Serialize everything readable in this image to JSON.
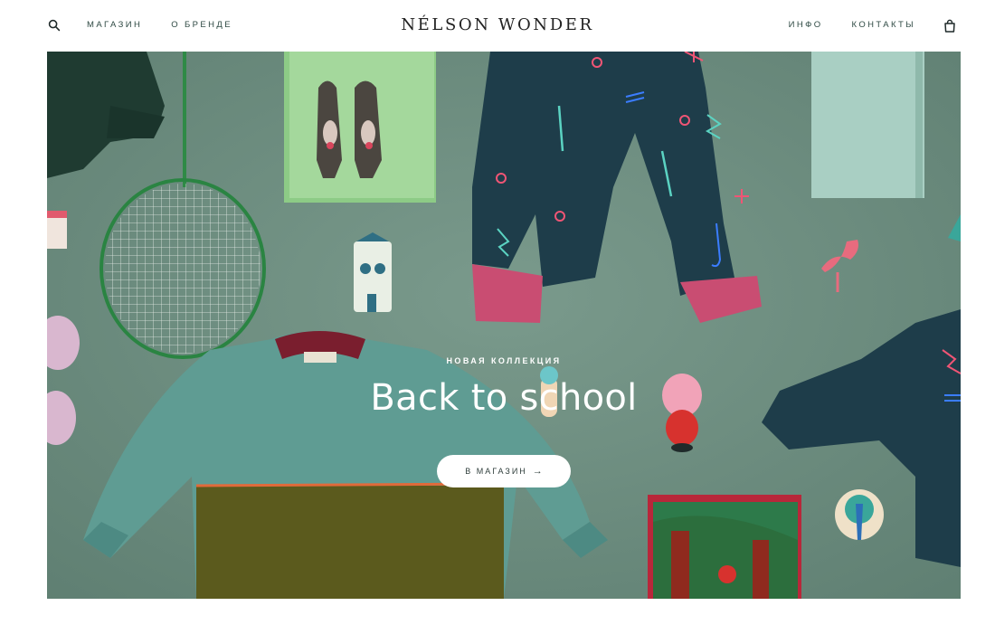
{
  "brand": {
    "name": "NÉLSON WONDER"
  },
  "nav": {
    "left": [
      {
        "label": "МАГАЗИН"
      },
      {
        "label": "О БРЕНДЕ"
      }
    ],
    "right": [
      {
        "label": "ИНФО"
      },
      {
        "label": "КОНТАКТЫ"
      }
    ],
    "icons": {
      "search": "search-icon",
      "cart": "shopping-bag-icon"
    }
  },
  "hero": {
    "eyebrow": "НОВАЯ КОЛЛЕКЦИЯ",
    "title": "Back to school",
    "cta_label": "В МАГАЗИН",
    "cta_arrow": "→",
    "background_color": "#6f8f82"
  },
  "colors": {
    "accent_text": "#2f4a44",
    "sweater_teal": "#5f9c93",
    "sweater_olive": "#5b5a1d",
    "pants_navy": "#1e3d4a",
    "cuff_pink": "#c94d72"
  }
}
